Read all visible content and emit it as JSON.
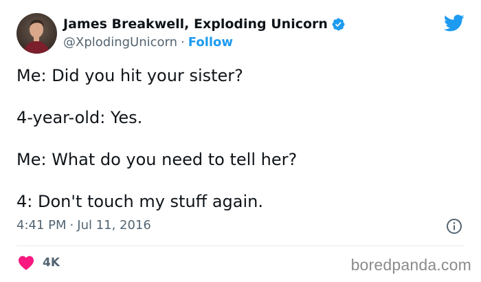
{
  "author": {
    "display_name": "James Breakwell, Exploding Unicorn",
    "handle": "@XplodingUnicorn",
    "separator": "·",
    "follow_label": "Follow"
  },
  "tweet": {
    "lines": [
      "Me: Did you hit your sister?",
      "4-year-old: Yes.",
      "Me: What do you need to tell her?",
      "4: Don't touch my stuff again."
    ],
    "time": "4:41 PM",
    "separator": "·",
    "date": "Jul 11, 2016"
  },
  "engagement": {
    "likes": "4K"
  },
  "watermark": "boredpanda.com",
  "colors": {
    "accent": "#1d9bf0",
    "heart": "#f91880",
    "secondary_text": "#536471"
  },
  "icons": {
    "verified": "verified-badge-icon",
    "platform": "twitter-bird-icon",
    "info": "info-icon",
    "like": "heart-icon"
  }
}
